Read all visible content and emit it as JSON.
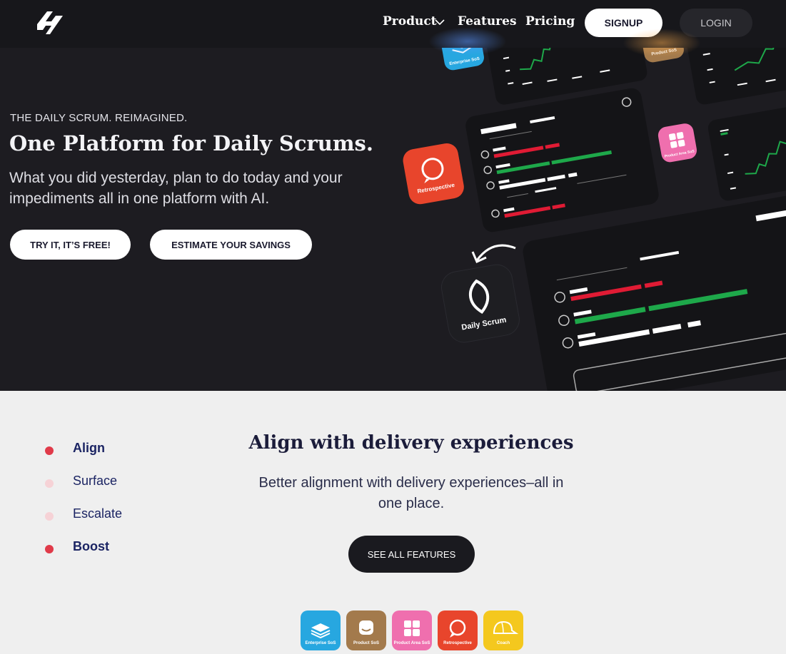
{
  "nav": {
    "logo_icon": "brand-logo-icon",
    "links": [
      {
        "label": "Product",
        "has_dropdown": true
      },
      {
        "label": "Features"
      },
      {
        "label": "Pricing"
      }
    ],
    "signup_label": "SIGNUP",
    "login_label": "LOGIN"
  },
  "hero": {
    "eyebrow": "THE DAILY SCRUM. REIMAGINED.",
    "title": "One Platform for Daily Scrums.",
    "subtitle": "What you did yesterday, plan to do today and your impediments all in one platform with AI.",
    "cta_primary": "TRY IT, IT’S FREE!",
    "cta_secondary": "ESTIMATE YOUR SAVINGS",
    "illustration": {
      "badges": [
        {
          "label": "Enterprise SoS",
          "color": "#27a7e0",
          "icon": "layers-icon"
        },
        {
          "label": "Product SoS",
          "color": "#a37a4c",
          "icon": "face-icon"
        },
        {
          "label": "Retrospective",
          "color": "#e8452c",
          "icon": "refresh-chat-icon"
        },
        {
          "label": "Product Area SoS",
          "color": "#ef6fae",
          "icon": "grid-icon"
        },
        {
          "label": "Daily Scrum",
          "color": "#1e1e22",
          "icon": "leaf-icon"
        }
      ],
      "status_colors": {
        "blocked": "#e01b34",
        "done": "#1ea84a",
        "neutral": "#ffffff"
      }
    }
  },
  "features": {
    "steps": [
      {
        "label": "Align",
        "active": true,
        "dot_color": "#e03a49"
      },
      {
        "label": "Surface",
        "active": false,
        "dot_color": "#f6d2d6"
      },
      {
        "label": "Escalate",
        "active": false,
        "dot_color": "#f6d2d6"
      },
      {
        "label": "Boost",
        "active": true,
        "dot_color": "#e03a49"
      }
    ],
    "title": "Align with delivery experiences",
    "subtitle": "Better alignment with delivery experiences–all in one place.",
    "cta": "SEE ALL FEATURES",
    "apps": [
      {
        "label": "Enterprise SoS",
        "color": "#27a7e0",
        "icon": "layers-icon"
      },
      {
        "label": "Product SoS",
        "color": "#a37a4c",
        "icon": "face-icon"
      },
      {
        "label": "Product Area SoS",
        "color": "#ef6fae",
        "icon": "grid-icon"
      },
      {
        "label": "Retrospective",
        "color": "#e8452c",
        "icon": "refresh-chat-icon"
      },
      {
        "label": "Coach",
        "color": "#f4c81e",
        "icon": "cap-icon"
      }
    ]
  }
}
